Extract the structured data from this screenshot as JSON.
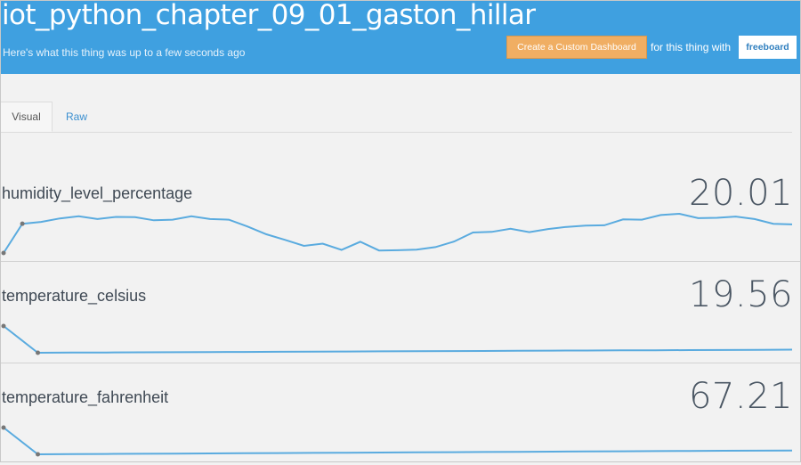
{
  "header": {
    "title": "iot_python_chapter_09_01_gaston_hillar",
    "subtitle": "Here's what this thing was up to a few seconds ago",
    "custom_dashboard_button": "Create a Custom Dashboard",
    "for_text": "for this thing with",
    "freeboard_button": "freeboard"
  },
  "tabs": [
    {
      "label": "Visual",
      "active": true
    },
    {
      "label": "Raw",
      "active": false
    }
  ],
  "metrics": [
    {
      "name": "humidity_level_percentage",
      "value": "20.01",
      "series": [
        14.8,
        24.2,
        24.8,
        25.9,
        26.6,
        25.7,
        26.4,
        26.3,
        25.3,
        25.5,
        26.6,
        25.7,
        25.5,
        23.3,
        20.8,
        19.0,
        17.1,
        17.8,
        15.8,
        18.4,
        15.6,
        15.7,
        15.9,
        16.7,
        18.5,
        21.4,
        21.6,
        22.6,
        21.5,
        22.5,
        23.2,
        23.6,
        23.7,
        25.6,
        25.5,
        27.0,
        27.4,
        26.0,
        26.1,
        26.5,
        25.7,
        24.2,
        24.0
      ]
    },
    {
      "name": "temperature_celsius",
      "value": "19.56",
      "series": [
        28.0,
        18.45,
        18.5,
        18.55,
        18.6,
        18.65,
        18.7,
        18.75,
        18.8,
        18.85,
        18.9,
        18.95,
        19.0,
        19.05,
        19.1,
        19.15,
        19.2,
        19.25,
        19.3,
        19.35,
        19.4,
        19.45,
        19.5,
        19.56
      ]
    },
    {
      "name": "temperature_fahrenheit",
      "value": "67.21",
      "series": [
        80.0,
        65.1,
        65.2,
        65.3,
        65.4,
        65.5,
        65.6,
        65.7,
        65.8,
        65.9,
        66.0,
        66.1,
        66.2,
        66.3,
        66.4,
        66.5,
        66.6,
        66.7,
        66.8,
        66.9,
        67.0,
        67.1,
        67.15,
        67.21
      ]
    }
  ],
  "colors": {
    "header_bg": "#3fa0e0",
    "accent_button": "#f0ae63",
    "line": "#5aabdf",
    "marker": "#777777"
  }
}
